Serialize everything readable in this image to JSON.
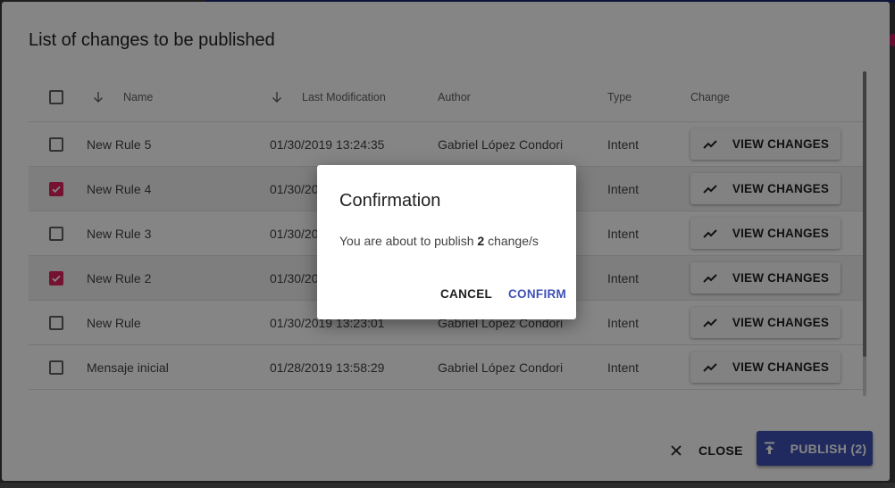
{
  "dialog": {
    "title": "List of changes to be published",
    "columns": {
      "name": "Name",
      "last_modification": "Last Modification",
      "author": "Author",
      "type": "Type",
      "change": "Change"
    },
    "rows": [
      {
        "name": "New Rule 5",
        "date": "01/30/2019 13:24:35",
        "author": "Gabriel López Condori",
        "type": "Intent",
        "checked": false,
        "action": "VIEW CHANGES"
      },
      {
        "name": "New Rule 4",
        "date": "01/30/20",
        "author": "",
        "type": "Intent",
        "checked": true,
        "action": "VIEW CHANGES"
      },
      {
        "name": "New Rule 3",
        "date": "01/30/20",
        "author": "",
        "type": "Intent",
        "checked": false,
        "action": "VIEW CHANGES"
      },
      {
        "name": "New Rule 2",
        "date": "01/30/20",
        "author": "",
        "type": "Intent",
        "checked": true,
        "action": "VIEW CHANGES"
      },
      {
        "name": "New Rule",
        "date": "01/30/2019 13:23:01",
        "author": "Gabriel López Condori",
        "type": "Intent",
        "checked": false,
        "action": "VIEW CHANGES"
      },
      {
        "name": "Mensaje inicial",
        "date": "01/28/2019 13:58:29",
        "author": "Gabriel López Condori",
        "type": "Intent",
        "checked": false,
        "action": "VIEW CHANGES"
      }
    ],
    "close_label": "CLOSE",
    "publish_label": "PUBLISH (2)"
  },
  "confirmation": {
    "title": "Confirmation",
    "message_prefix": "You are about to publish ",
    "count": "2",
    "message_suffix": " change/s",
    "cancel_label": "CANCEL",
    "confirm_label": "CONFIRM"
  },
  "colors": {
    "accent": "#3f51b5",
    "checkbox_checked": "#e0245e"
  },
  "icons": {
    "sort": "arrow-down-icon",
    "view_changes": "trending-icon",
    "close": "close-icon",
    "publish": "publish-icon"
  }
}
